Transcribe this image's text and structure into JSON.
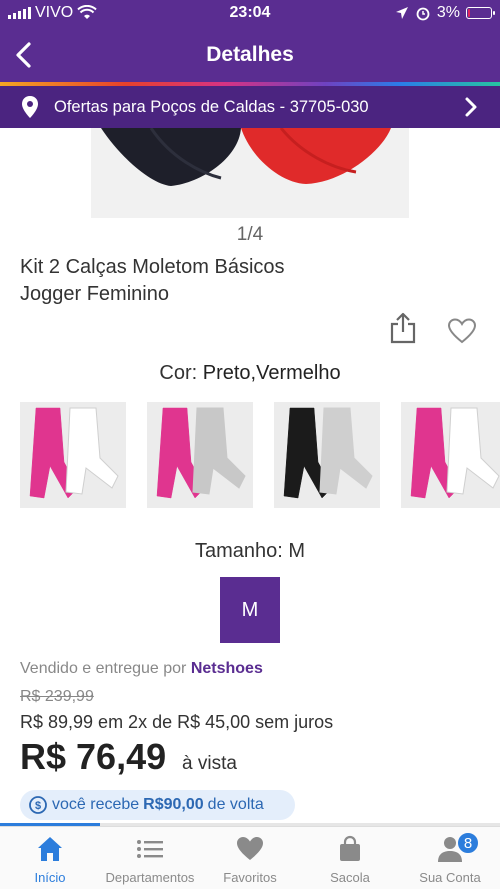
{
  "status_bar": {
    "carrier": "VIVO",
    "time": "23:04",
    "battery": "3%",
    "battery_level": 0.03
  },
  "nav": {
    "title": "Detalhes"
  },
  "location": {
    "text": "Ofertas para Poços de Caldas - 37705-030"
  },
  "gallery": {
    "pager": "1/4"
  },
  "product": {
    "title_line1": "Kit 2 Calças Moletom Básicos",
    "title_line2": "Jogger Feminino",
    "color_label": "Cor:",
    "color_value": "Preto,Vermelho",
    "thumbnails": [
      {
        "colors": [
          "#e0358f",
          "#ffffff"
        ]
      },
      {
        "colors": [
          "#e0358f",
          "#c8c8c8"
        ]
      },
      {
        "colors": [
          "#1b1b1b",
          "#cfcfcf"
        ]
      },
      {
        "colors": [
          "#e0358f",
          "#ffffff"
        ]
      }
    ],
    "size_label": "Tamanho: M",
    "size_option": "M"
  },
  "pricing": {
    "seller_prefix": "Vendido e entregue por",
    "seller_name": "Netshoes",
    "old_price": "R$ 239,99",
    "installments": "R$ 89,99 em 2x de R$ 45,00 sem juros",
    "price": "R$ 76,49",
    "price_suffix": "à vista",
    "cashback_prefix": "você recebe",
    "cashback_amount": "R$90,00",
    "cashback_suffix": "de volta"
  },
  "scroll_progress": 0.2,
  "tabbar": {
    "tabs": [
      {
        "label": "Início",
        "icon": "home-icon"
      },
      {
        "label": "Departamentos",
        "icon": "list-icon"
      },
      {
        "label": "Favoritos",
        "icon": "heart-icon"
      },
      {
        "label": "Sacola",
        "icon": "bag-icon"
      },
      {
        "label": "Sua Conta",
        "icon": "user-icon"
      }
    ],
    "account_badge": "8"
  },
  "colors": {
    "brand": "#5a2d91",
    "accent": "#2c7ddc"
  }
}
